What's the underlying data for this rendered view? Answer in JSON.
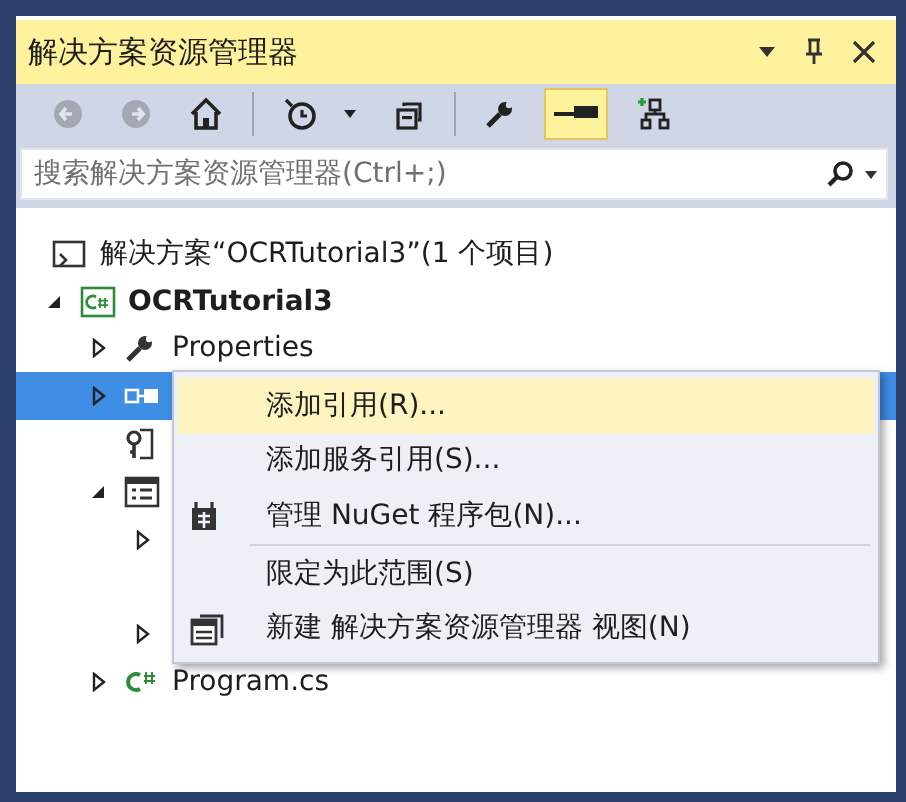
{
  "panel": {
    "title": "解决方案资源管理器"
  },
  "title_buttons": [
    {
      "kind": "dropdown"
    },
    {
      "kind": "pin"
    },
    {
      "kind": "close"
    }
  ],
  "toolbar": [
    {
      "kind": "back",
      "disabled": true,
      "selected": false
    },
    {
      "kind": "forward",
      "disabled": true,
      "selected": false
    },
    {
      "kind": "home",
      "disabled": false,
      "selected": false
    },
    {
      "kind": "separator"
    },
    {
      "kind": "history",
      "disabled": false,
      "selected": false
    },
    {
      "kind": "caret",
      "disabled": false,
      "selected": false
    },
    {
      "kind": "collapse",
      "disabled": false,
      "selected": false
    },
    {
      "kind": "separator"
    },
    {
      "kind": "wrench",
      "disabled": false,
      "selected": false
    },
    {
      "kind": "preview",
      "disabled": false,
      "selected": true
    },
    {
      "kind": "diagram",
      "disabled": false,
      "selected": false
    }
  ],
  "search": {
    "placeholder": "搜索解决方案资源管理器(Ctrl+;)"
  },
  "tree": [
    {
      "kind": "solution",
      "expandable": false,
      "label": "解决方案“OCRTutorial3”(1 个项目)",
      "selected": false
    },
    {
      "kind": "project",
      "expandable": true,
      "expanded": true,
      "label": "OCRTutorial3",
      "selected": false,
      "children": [
        {
          "kind": "wrench",
          "expandable": true,
          "expanded": false,
          "label": "Properties",
          "selected": false
        },
        {
          "kind": "references",
          "expandable": true,
          "expanded": false,
          "selected": true
        },
        {
          "kind": "config",
          "expandable": false,
          "selected": false
        },
        {
          "kind": "form",
          "expandable": true,
          "expanded": true,
          "selected": false,
          "children": [
            {
              "expandable": true,
              "expanded": false,
              "selected": false
            },
            {
              "expandable": false,
              "selected": false
            },
            {
              "expandable": true,
              "expanded": false,
              "selected": false
            }
          ]
        },
        {
          "kind": "csfile",
          "expandable": true,
          "expanded": false,
          "label": "Program.cs",
          "selected": false
        }
      ]
    }
  ],
  "context_menu": [
    {
      "kind": "plain",
      "label": "添加引用(R)...",
      "selected": true
    },
    {
      "kind": "plain",
      "label": "添加服务引用(S)...",
      "selected": false
    },
    {
      "kind": "package",
      "label": "管理 NuGet 程序包(N)...",
      "selected": false
    },
    {
      "kind": "separator"
    },
    {
      "kind": "plain",
      "label": "限定为此范围(S)",
      "selected": false
    },
    {
      "kind": "window",
      "label": "新建 解决方案资源管理器 视图(N)",
      "selected": false
    }
  ]
}
